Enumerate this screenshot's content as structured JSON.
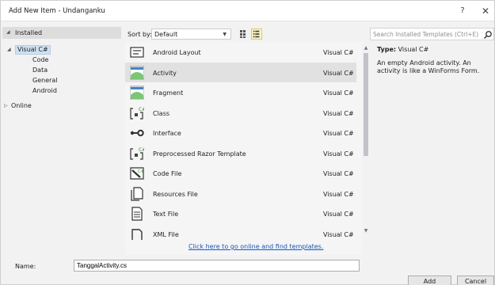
{
  "window": {
    "title": "Add New Item - Undanganku",
    "help": "?",
    "close": "✕"
  },
  "tree": {
    "installed": "Installed",
    "root": "Visual C#",
    "children": [
      "Code",
      "Data",
      "General",
      "Android"
    ],
    "online": "Online"
  },
  "sort": {
    "label": "Sort by:",
    "value": "Default"
  },
  "templates": [
    {
      "name": "Android Layout",
      "lang": "Visual C#",
      "icon": "android-layout-icon"
    },
    {
      "name": "Activity",
      "lang": "Visual C#",
      "icon": "activity-icon",
      "selected": true
    },
    {
      "name": "Fragment",
      "lang": "Visual C#",
      "icon": "fragment-icon"
    },
    {
      "name": "Class",
      "lang": "Visual C#",
      "icon": "class-icon"
    },
    {
      "name": "Interface",
      "lang": "Visual C#",
      "icon": "interface-icon"
    },
    {
      "name": "Preprocessed Razor Template",
      "lang": "Visual C#",
      "icon": "razor-template-icon"
    },
    {
      "name": "Code File",
      "lang": "Visual C#",
      "icon": "code-file-icon"
    },
    {
      "name": "Resources File",
      "lang": "Visual C#",
      "icon": "resources-file-icon"
    },
    {
      "name": "Text File",
      "lang": "Visual C#",
      "icon": "text-file-icon"
    },
    {
      "name": "XML File",
      "lang": "Visual C#",
      "icon": "xml-file-icon"
    }
  ],
  "online_link": "Click here to go online and find templates.",
  "search": {
    "placeholder": "Search Installed Templates (Ctrl+E)"
  },
  "details": {
    "type_label": "Type:",
    "type_value": "Visual C#",
    "description": "An empty Android activity.  An activity is like a WinForms Form."
  },
  "footer": {
    "name_label": "Name:",
    "name_value": "TanggalActivity.cs",
    "add": "Add",
    "cancel": "Cancel"
  },
  "colors": {
    "selection": "#e1e1e1",
    "link": "#1a55b5",
    "android": "#7cc576"
  }
}
